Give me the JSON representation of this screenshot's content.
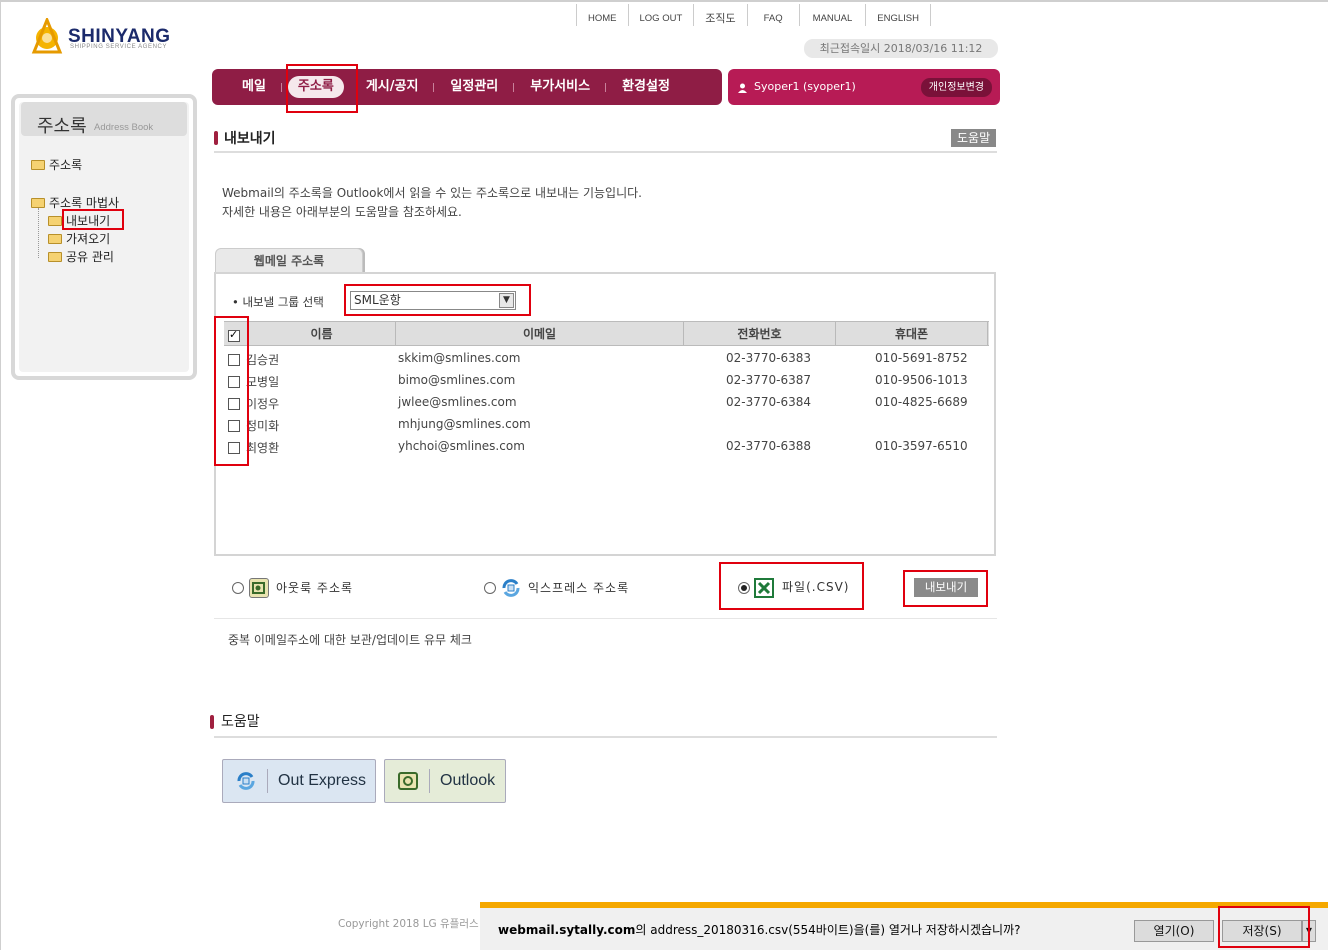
{
  "logo": {
    "name": "SHINYANG",
    "tagline": "SHIPPING SERVICE AGENCY"
  },
  "toplinks": [
    "HOME",
    "LOG OUT",
    "조직도",
    "FAQ",
    "MANUAL",
    "ENGLISH"
  ],
  "last_login": "최근접속일시 2018/03/16 11:12",
  "nav": {
    "items": [
      "메일",
      "주소록",
      "게시/공지",
      "일정관리",
      "부가서비스",
      "환경설정"
    ],
    "active": "주소록"
  },
  "user": {
    "name": "Syoper1 (syoper1)",
    "profile_button": "개인정보변경"
  },
  "sidebar": {
    "title": "주소록",
    "title_en": "Address Book",
    "items": [
      "주소록",
      "주소록 마법사",
      "내보내기",
      "가져오기",
      "공유 관리"
    ]
  },
  "section": {
    "title": "내보내기",
    "help_badge": "도움말"
  },
  "description": [
    "Webmail의 주소록을 Outlook에서 읽을 수 있는 주소록으로 내보내는 기능입니다.",
    "자세한 내용은 아래부분의 도움말을 참조하세요."
  ],
  "tab_label": "웹메일 주소록",
  "group_select": {
    "label": "• 내보낼 그룹 선택",
    "value": "SML운항"
  },
  "table": {
    "headers": [
      "이름",
      "이메일",
      "전화번호",
      "휴대폰"
    ],
    "rows": [
      {
        "name": "김승권",
        "email": "skkim@smlines.com",
        "phone": "02-3770-6383",
        "mobile": "010-5691-8752"
      },
      {
        "name": "모병일",
        "email": "bimo@smlines.com",
        "phone": "02-3770-6387",
        "mobile": "010-9506-1013"
      },
      {
        "name": "이정우",
        "email": "jwlee@smlines.com",
        "phone": "02-3770-6384",
        "mobile": "010-4825-6689"
      },
      {
        "name": "정미화",
        "email": "mhjung@smlines.com",
        "phone": "",
        "mobile": ""
      },
      {
        "name": "최영환",
        "email": "yhchoi@smlines.com",
        "phone": "02-3770-6388",
        "mobile": "010-3597-6510"
      }
    ]
  },
  "export_options": {
    "outlook": "아웃룩 주소록",
    "express": "익스프레스 주소록",
    "csv": "파일(.CSV)",
    "selected": "csv",
    "export_button": "내보내기"
  },
  "dup_check": "중복 이메일주소에 대한 보관/업데이트 유무 체크",
  "help": {
    "title": "도움말",
    "out_express": "Out Express",
    "outlook": "Outlook"
  },
  "copyright": "Copyright 2018 LG 유플러스",
  "download_bar": {
    "site": "webmail.sytally.com",
    "message": "의 address_20180316.csv(554바이트)을(를) 열거나 저장하시겠습니까?",
    "open": "열기(O)",
    "save": "저장(S)"
  },
  "colors": {
    "nav_bg": "#8f1d45",
    "user_bg": "#b71b55",
    "highlight": "#e0000e",
    "download_accent": "#f5a800"
  }
}
